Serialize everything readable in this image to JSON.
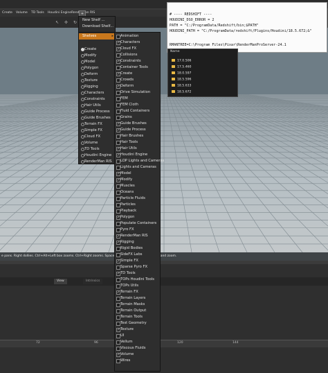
{
  "shelf_tabs": [
    "Create",
    "Volume",
    "TD Tools",
    "Houdini Engine",
    "RenderMan RIS"
  ],
  "shelf_menu": {
    "items": [
      "New Shelf ...",
      "Download Shelf..."
    ]
  },
  "shelves_label": "Shelves",
  "shelf_list": {
    "items": [
      {
        "label": "Create",
        "selected": true
      },
      {
        "label": "Modify",
        "selected": false
      },
      {
        "label": "Model",
        "selected": false
      },
      {
        "label": "Polygon",
        "selected": false
      },
      {
        "label": "Deform",
        "selected": false
      },
      {
        "label": "Texture",
        "selected": false
      },
      {
        "label": "Rigging",
        "selected": false
      },
      {
        "label": "Characters",
        "selected": false
      },
      {
        "label": "Constraints",
        "selected": false
      },
      {
        "label": "Hair Utils",
        "selected": false
      },
      {
        "label": "Guide Process",
        "selected": false
      },
      {
        "label": "Guide Brushes",
        "selected": false
      },
      {
        "label": "Terrain FX",
        "selected": false
      },
      {
        "label": "Simple FX",
        "selected": false
      },
      {
        "label": "Cloud FX",
        "selected": false
      },
      {
        "label": "Volume",
        "selected": false
      },
      {
        "label": "TD Tools",
        "selected": false
      },
      {
        "label": "Houdini Engine",
        "selected": false
      },
      {
        "label": "RenderMan RIS",
        "selected": false
      }
    ]
  },
  "shelf_checklist": {
    "items": [
      {
        "label": "Animation",
        "checked": false
      },
      {
        "label": "Characters",
        "checked": true
      },
      {
        "label": "Cloud FX",
        "checked": true
      },
      {
        "label": "Collisions",
        "checked": false
      },
      {
        "label": "Constraints",
        "checked": true
      },
      {
        "label": "Container Tools",
        "checked": false
      },
      {
        "label": "Create",
        "checked": true
      },
      {
        "label": "Crowds",
        "checked": false
      },
      {
        "label": "Deform",
        "checked": true
      },
      {
        "label": "Drive Simulation",
        "checked": false
      },
      {
        "label": "FEM",
        "checked": false
      },
      {
        "label": "FEM Cloth",
        "checked": false
      },
      {
        "label": "Fluid Containers",
        "checked": false
      },
      {
        "label": "Grains",
        "checked": false
      },
      {
        "label": "Guide Brushes",
        "checked": true
      },
      {
        "label": "Guide Process",
        "checked": true
      },
      {
        "label": "Hair Brushes",
        "checked": false
      },
      {
        "label": "Hair Tools",
        "checked": false
      },
      {
        "label": "Hair Utils",
        "checked": true
      },
      {
        "label": "Houdini Engine",
        "checked": true
      },
      {
        "label": "LOP Lights and Cameras",
        "checked": false
      },
      {
        "label": "Lights and Cameras",
        "checked": false
      },
      {
        "label": "Model",
        "checked": true
      },
      {
        "label": "Modify",
        "checked": true
      },
      {
        "label": "Muscles",
        "checked": false
      },
      {
        "label": "Oceans",
        "checked": false
      },
      {
        "label": "Particle Fluids",
        "checked": false
      },
      {
        "label": "Particles",
        "checked": false
      },
      {
        "label": "Playback",
        "checked": false
      },
      {
        "label": "Polygon",
        "checked": true
      },
      {
        "label": "Populate Containers",
        "checked": false
      },
      {
        "label": "Pyro FX",
        "checked": false
      },
      {
        "label": "RenderMan RIS",
        "checked": true
      },
      {
        "label": "Rigging",
        "checked": true
      },
      {
        "label": "Rigid Bodies",
        "checked": false
      },
      {
        "label": "SideFX Labs",
        "checked": false
      },
      {
        "label": "Simple FX",
        "checked": true
      },
      {
        "label": "Sparse Pyro FX",
        "checked": false
      },
      {
        "label": "TD Tools",
        "checked": true
      },
      {
        "label": "TOPs Houdini Tools",
        "checked": false
      },
      {
        "label": "TOPs Utils",
        "checked": false
      },
      {
        "label": "Terrain FX",
        "checked": true
      },
      {
        "label": "Terrain Layers",
        "checked": false
      },
      {
        "label": "Terrain Masks",
        "checked": false
      },
      {
        "label": "Terrain Output",
        "checked": false
      },
      {
        "label": "Terrain Tools",
        "checked": false
      },
      {
        "label": "Test Geometry",
        "checked": false
      },
      {
        "label": "Texture",
        "checked": true
      },
      {
        "label": "UI",
        "checked": false
      },
      {
        "label": "Vellum",
        "checked": false
      },
      {
        "label": "Viscous Fluids",
        "checked": false
      },
      {
        "label": "Volume",
        "checked": true
      },
      {
        "label": "Wires",
        "checked": false
      }
    ]
  },
  "env_text": {
    "lines": [
      "# ---- REDSHIFT ----",
      "HOUDINI_DSO_ERROR = 2",
      "PATH = \"C:/ProgramData/Redshift/bin;$PATH\"",
      "HOUDINI_PATH = \"C:/ProgramData/redshift/Plugins/Houdini/18.5.672;&\"",
      "",
      "RMANTREE=C:\\Program Files\\Pixar\\RenderManProServer-24.1"
    ]
  },
  "file_browser": {
    "header": "Name",
    "folders": [
      "17.0.506",
      "17.5.460",
      "18.0.597",
      "18.5.596",
      "18.5.633",
      "18.5.672"
    ]
  },
  "help_text": "e pans. Right dollies. Ctrl+Alt+Left box zooms. Ctrl+Right zooms. Spacebar-Ctrl-Left ... tumble, dolly, and zoom.",
  "lower_tabs": {
    "view": "View",
    "intrinsics": "Intrinsics"
  },
  "timeline_ticks": [
    "72",
    "96",
    "120",
    "144"
  ],
  "colors": {
    "menu_highlight": "#c8771c",
    "menu_bg": "#2e2e2e"
  }
}
